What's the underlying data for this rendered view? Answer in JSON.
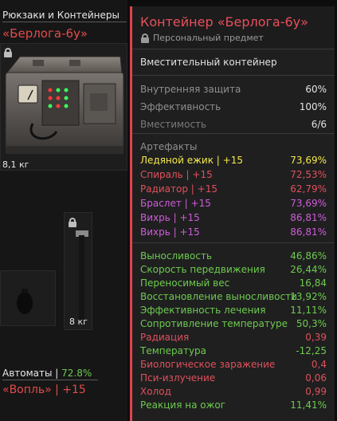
{
  "inventory": {
    "category": "Рюкзаки и Контейнеры",
    "item_name": "«Берлога-6у»",
    "item_weight": "8,1 кг",
    "pickaxe_weight": "8 кг",
    "bottom_category": "Автоматы |",
    "bottom_category_pct": "72.8%",
    "bottom_item": "«Вопль» | +15"
  },
  "panel": {
    "title": "Контейнер «Берлога-6у»",
    "subtitle": "Персональный предмет",
    "description": "Вместительный контейнер",
    "stats": [
      {
        "label": "Внутренняя защита",
        "value": "60%"
      },
      {
        "label": "Эффективность",
        "value": "100%"
      },
      {
        "label": "Вместимость",
        "value": "6/6"
      }
    ],
    "artifacts_title": "Артефакты",
    "artifacts": [
      {
        "label": "Ледяной ежик | +15",
        "value": "73,69%",
        "color": "#f5e94a"
      },
      {
        "label": "Спираль | +15",
        "value": "72,53%",
        "color": "#e0505a"
      },
      {
        "label": "Радиатор | +15",
        "value": "62,79%",
        "color": "#e0505a"
      },
      {
        "label": "Браслет | +15",
        "value": "73,69%",
        "color": "#d05cd9"
      },
      {
        "label": "Вихрь | +15",
        "value": "86,81%",
        "color": "#d05cd9"
      },
      {
        "label": "Вихрь | +15",
        "value": "86,81%",
        "color": "#d05cd9"
      }
    ],
    "effects": [
      {
        "label": "Выносливость",
        "value": "46,86%",
        "color": "#6ecb4e"
      },
      {
        "label": "Скорость передвижения",
        "value": "26,44%",
        "color": "#6ecb4e"
      },
      {
        "label": "Переносимый вес",
        "value": "16,84",
        "color": "#6ecb4e"
      },
      {
        "label": "Восстановление выносливости",
        "value": "13,92%",
        "color": "#6ecb4e"
      },
      {
        "label": "Эффективность лечения",
        "value": "11,11%",
        "color": "#6ecb4e"
      },
      {
        "label": "Сопротивление температуре",
        "value": "50,3%",
        "color": "#6ecb4e"
      },
      {
        "label": "Радиация",
        "value": "0,39",
        "color": "#e0505a"
      },
      {
        "label": "Температура",
        "value": "-12,25",
        "color": "#6ecb4e"
      },
      {
        "label": "Биологическое заражение",
        "value": "0,4",
        "color": "#e0505a"
      },
      {
        "label": "Пси-излучение",
        "value": "0,06",
        "color": "#e0505a"
      },
      {
        "label": "Холод",
        "value": "0,99",
        "color": "#e0505a"
      },
      {
        "label": "Реакция на ожог",
        "value": "11,41%",
        "color": "#6ecb4e"
      }
    ],
    "accent_color": "#e0434d"
  }
}
